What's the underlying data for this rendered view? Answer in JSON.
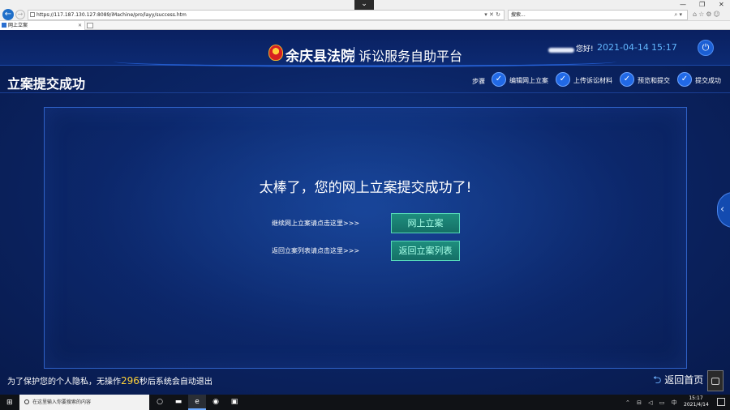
{
  "browser": {
    "url": "https://117.187.130.127:8089/iMachine/pro/layy/success.htm",
    "search_placeholder": "搜索...",
    "tab_title": "网上立案"
  },
  "header": {
    "court_name": "余庆县法院",
    "platform_name": "诉讼服务自助平台",
    "greeting": "您好!",
    "date": "2021-04-14",
    "time": "15:17"
  },
  "page": {
    "title": "立案提交成功",
    "steps_label": "步骤",
    "steps": [
      {
        "label": "编辑网上立案"
      },
      {
        "label": "上传诉讼材料"
      },
      {
        "label": "预览和提交"
      },
      {
        "label": "提交成功"
      }
    ]
  },
  "main": {
    "success_message": "太棒了，您的网上立案提交成功了!",
    "continue_text": "继续网上立案请点击这里>>>",
    "continue_button": "网上立案",
    "return_text": "返回立案列表请点击这里>>>",
    "return_button": "返回立案列表"
  },
  "footer": {
    "privacy_prefix": "为了保护您的个人隐私，无操作",
    "countdown": "296",
    "privacy_suffix": "秒后系统会自动退出",
    "back_home": "返回首页"
  },
  "taskbar": {
    "search_placeholder": "在这里输入你要搜索的内容",
    "ime": "中",
    "time": "15:17",
    "date": "2021/4/14"
  },
  "colors": {
    "accent": "#2169e6",
    "button_green": "#1e8e7e",
    "date_blue": "#63b8ff",
    "countdown_yellow": "#ffd33a"
  }
}
